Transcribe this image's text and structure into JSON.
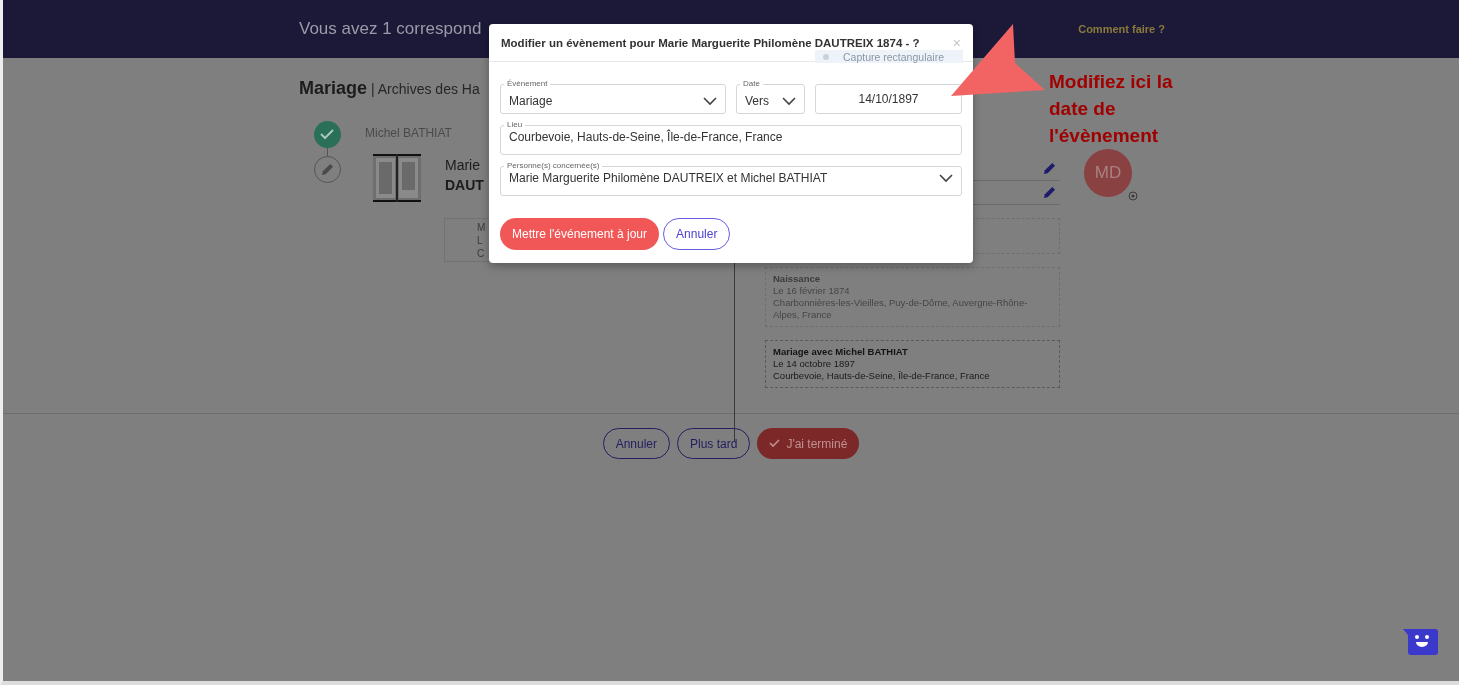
{
  "header": {
    "title": "Vous avez 1 correspond",
    "help_link": "Comment faire ?"
  },
  "page": {
    "heading": "Mariage",
    "source": "| Archives des Ha",
    "left": {
      "person": "Michel BATHIAT",
      "step_done": true,
      "name_line_1": "Marie",
      "name_line_2": "DAUT",
      "card_lines": [
        "M",
        "L",
        "C"
      ]
    },
    "right": {
      "avatar": "MD",
      "events": [
        {
          "highlighted": false
        },
        {
          "title": "Naissance",
          "lines": [
            "Le 16 février 1874",
            "Charbonnières-les-Vieilles, Puy-de-Dôme, Auvergne-Rhône-Alpes, France"
          ],
          "highlighted": false
        },
        {
          "title": "Mariage avec Michel BATHIAT",
          "lines": [
            "Le 14 octobre 1897",
            "Courbevoie, Hauts-de-Seine, Île-de-France, France"
          ],
          "highlighted": true
        }
      ]
    }
  },
  "footer_buttons": [
    {
      "label": "Annuler",
      "kind": "outline"
    },
    {
      "label": "Plus tard",
      "kind": "outline"
    },
    {
      "label": "J'ai terminé",
      "kind": "primary"
    }
  ],
  "modal": {
    "title": "Modifier un évènement pour Marie Marguerite Philomène DAUTREIX 1874 - ?",
    "close": "×",
    "event_field": {
      "label": "Évènement",
      "value": "Mariage"
    },
    "date_mode_field": {
      "label": "Date",
      "value": "Vers"
    },
    "date_field": {
      "value": "14/10/1897"
    },
    "place_field": {
      "label": "Lieu",
      "value": "Courbevoie, Hauts-de-Seine, Île-de-France, France"
    },
    "persons_field": {
      "label": "Personne(s) concernée(s)",
      "value": "Marie Marguerite Philomène DAUTREIX et Michel BATHIAT"
    },
    "buttons": [
      {
        "label": "Mettre l'événement à jour",
        "kind": "primary"
      },
      {
        "label": "Annuler",
        "kind": "outline"
      }
    ]
  },
  "capture_tooltip": "Capture rectangulaire",
  "annotation": {
    "lines": [
      "Modifiez ici la",
      "date de",
      "l'évènement"
    ]
  }
}
